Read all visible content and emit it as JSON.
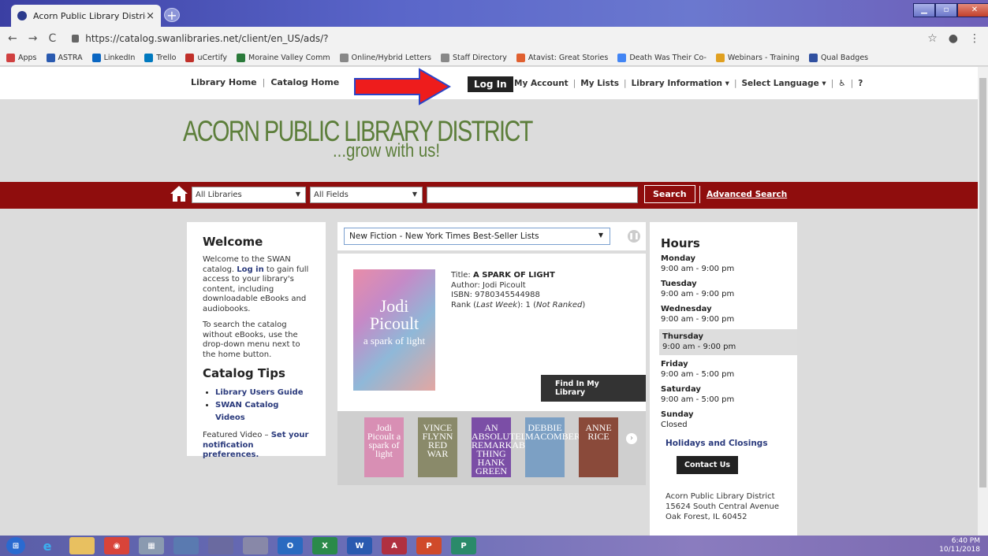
{
  "browser": {
    "tab_title": "Acorn Public Library District",
    "tab_close": "×",
    "new_tab": "+",
    "url": "https://catalog.swanlibraries.net/client/en_US/ads/?",
    "bookmarks": [
      "Apps",
      "ASTRA",
      "LinkedIn",
      "Trello",
      "uCertify",
      "Moraine Valley Comm",
      "Online/Hybrid Letters",
      "Staff Directory",
      "Atavist: Great Stories",
      "Death Was Their Co-",
      "Webinars - Training",
      "Qual Badges"
    ]
  },
  "topnav": {
    "library_home": "Library Home",
    "sep": "|",
    "catalog_home": "Catalog Home",
    "login": "Log In",
    "my_account": "My Account",
    "my_lists": "My Lists",
    "library_info": "Library Information ▾",
    "select_language": "Select Language ▾",
    "accessibility": "♿",
    "help": "?"
  },
  "logo": {
    "line1": "ACORN PUBLIC LIBRARY DISTRICT",
    "line2": "...grow with us!"
  },
  "search": {
    "library_select": "All Libraries",
    "field_select": "All Fields",
    "button": "Search",
    "advanced": "Advanced Search"
  },
  "welcome": {
    "heading": "Welcome",
    "p1_pre": "Welcome to the SWAN catalog.",
    "p1_link": "Log in",
    "p1_post": " to gain full access to your library's content, including downloadable eBooks and audiobooks.",
    "p2": "To search the catalog without eBooks, use the drop-down menu next to the home button.",
    "tips_heading": "Catalog Tips",
    "tips": [
      "Library Users Guide",
      "SWAN Catalog Videos"
    ],
    "featured_pre": "Featured Video – ",
    "featured_link": "Set your notification preferences."
  },
  "carousel": {
    "list_select": "New Fiction - New York Times Best-Seller Lists",
    "cover_author": "Jodi Picoult",
    "cover_title": "a spark of light",
    "title_label": "Title: ",
    "title": "A SPARK OF LIGHT",
    "author": "Author: Jodi Picoult",
    "isbn": "ISBN: 9780345544988",
    "rank_pre": "Rank (",
    "rank_last": "Last Week",
    "rank_mid": "): 1 (",
    "rank_nr": "Not Ranked",
    "rank_post": ")",
    "find_button": "Find In My Library",
    "thumbs": [
      {
        "text": "Jodi Picoult a spark of light",
        "color": "#d88fb4"
      },
      {
        "text": "VINCE FLYNN RED WAR",
        "color": "#8a8a6a"
      },
      {
        "text": "AN ABSOLUTELY REMARKABLE THING HANK GREEN",
        "color": "#7b4ea6"
      },
      {
        "text": "DEBBIE MACOMBER",
        "color": "#7ca0c4"
      },
      {
        "text": "ANNE RICE",
        "color": "#8a4a3a"
      }
    ]
  },
  "hours": {
    "heading": "Hours",
    "days": [
      {
        "day": "Monday",
        "time": "9:00 am - 9:00 pm"
      },
      {
        "day": "Tuesday",
        "time": "9:00 am - 9:00 pm"
      },
      {
        "day": "Wednesday",
        "time": "9:00 am - 9:00 pm"
      },
      {
        "day": "Thursday",
        "time": "9:00 am - 9:00 pm"
      },
      {
        "day": "Friday",
        "time": "9:00 am - 5:00 pm"
      },
      {
        "day": "Saturday",
        "time": "9:00 am - 5:00 pm"
      },
      {
        "day": "Sunday",
        "time": "Closed"
      }
    ],
    "holidays": "Holidays and Closings",
    "contact": "Contact Us",
    "address": [
      "Acorn Public Library District",
      "15624 South Central Avenue",
      "Oak Forest, IL 60452"
    ]
  },
  "taskbar": {
    "time": "6:40 PM",
    "date": "10/11/2018"
  }
}
